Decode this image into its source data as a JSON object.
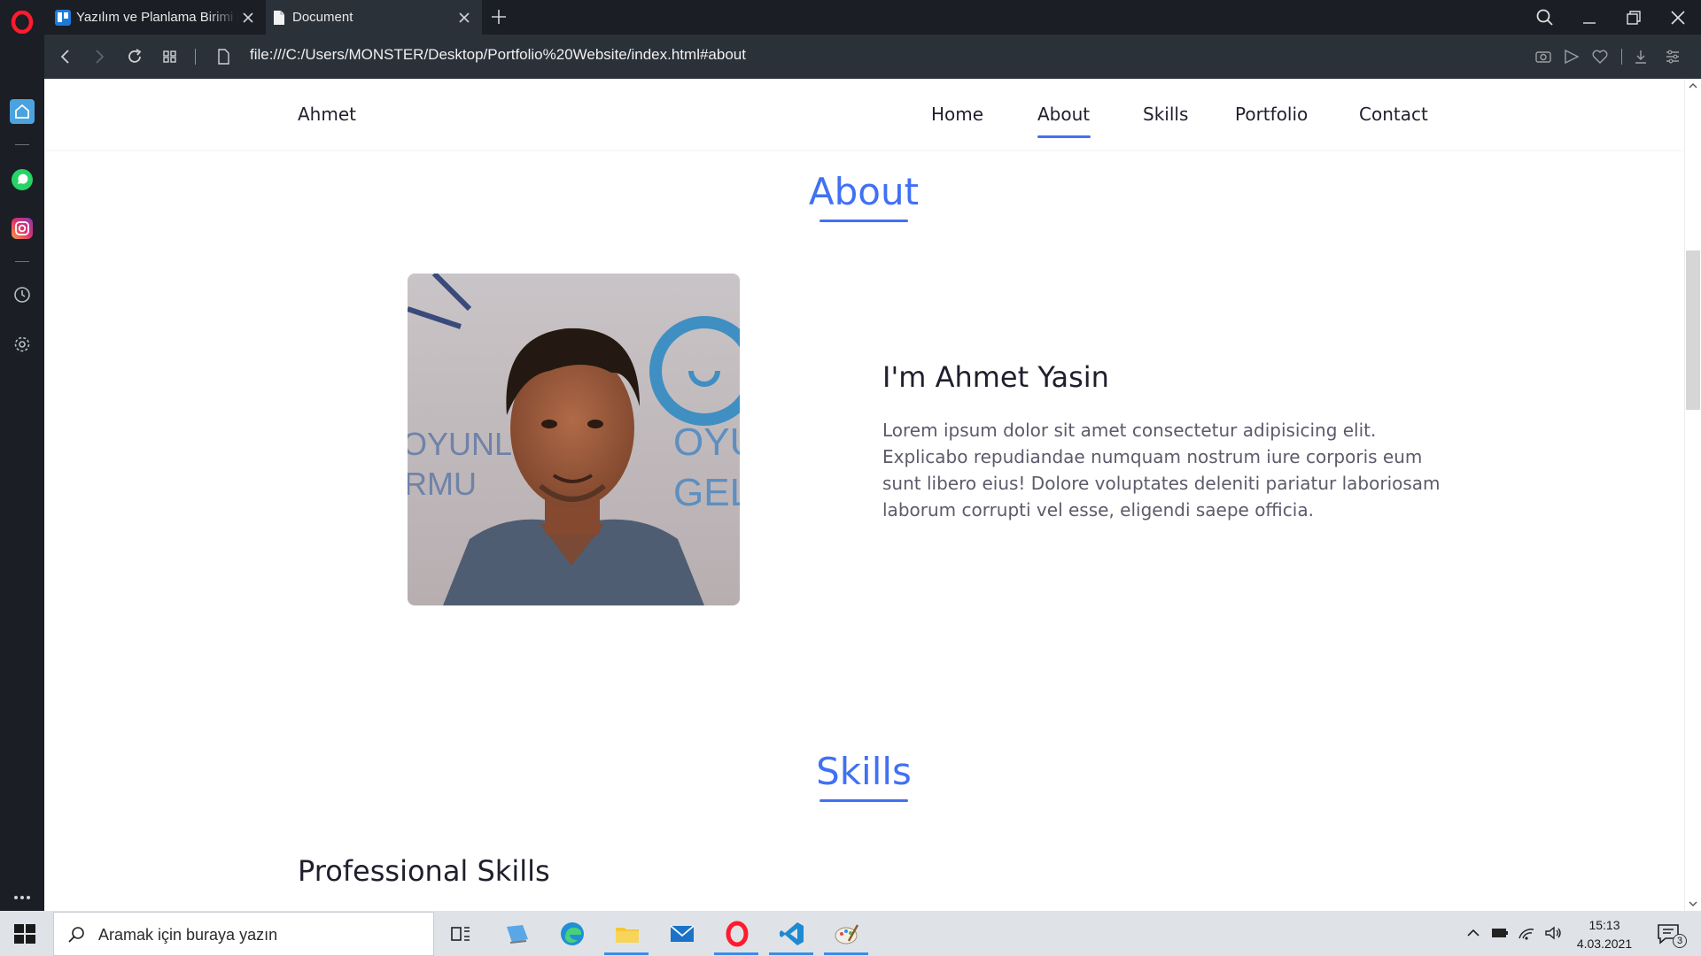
{
  "browser": {
    "tabs": [
      {
        "label": "Yazılım ve Planlama Birimi ("
      },
      {
        "label": "Document"
      }
    ],
    "url": "file:///C:/Users/MONSTER/Desktop/Portfolio%20Website/index.html#about"
  },
  "page": {
    "nav": {
      "brand": "Ahmet",
      "links": [
        {
          "label": "Home"
        },
        {
          "label": "About"
        },
        {
          "label": "Skills"
        },
        {
          "label": "Portfolio"
        },
        {
          "label": "Contact"
        }
      ],
      "active": "About"
    },
    "about": {
      "title": "About",
      "name": "I'm Ahmet Yasin",
      "text": "Lorem ipsum dolor sit amet consectetur adipisicing elit. Explicabo repudiandae numquam nostrum iure corporis eum sunt libero eius! Dolore voluptates deleniti pariatur laboriosam laborum corrupti vel esse, eligendi saepe officia.",
      "photo_bg_text_left": "OYUNL\nRMU",
      "photo_bg_text_right": "OYUN\nGELEC"
    },
    "skills": {
      "title": "Skills",
      "subtitle": "Professional Skills"
    },
    "accent_color": "#4070f4"
  },
  "taskbar": {
    "search_placeholder": "Aramak için buraya yazın",
    "time": "15:13",
    "date": "4.03.2021",
    "notification_count": "3"
  }
}
